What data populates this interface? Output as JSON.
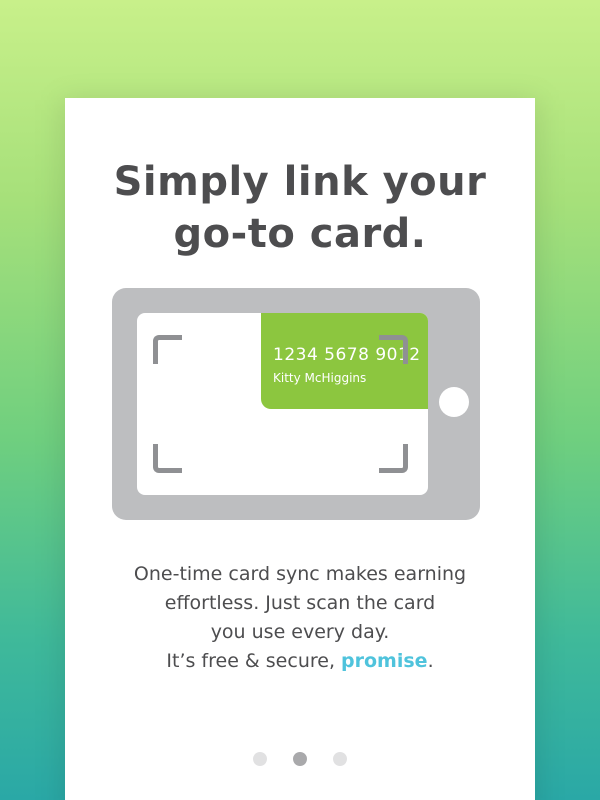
{
  "headline": {
    "line1": "Simply link your",
    "line2": "go-to card."
  },
  "illustration": {
    "card_number": "1234 5678 9012",
    "card_holder": "Kitty McHiggins",
    "card_color": "#8cc63f",
    "phone_color": "#bdbec0"
  },
  "description": {
    "line1": "One-time card sync makes earning",
    "line2": "effortless. Just scan the card",
    "line3": "you use every day.",
    "line4_prefix": "It’s free & secure, ",
    "line4_link": "promise",
    "line4_suffix": ".",
    "link_color": "#4fc3dc"
  },
  "pagination": {
    "total": 3,
    "active_index": 1
  }
}
